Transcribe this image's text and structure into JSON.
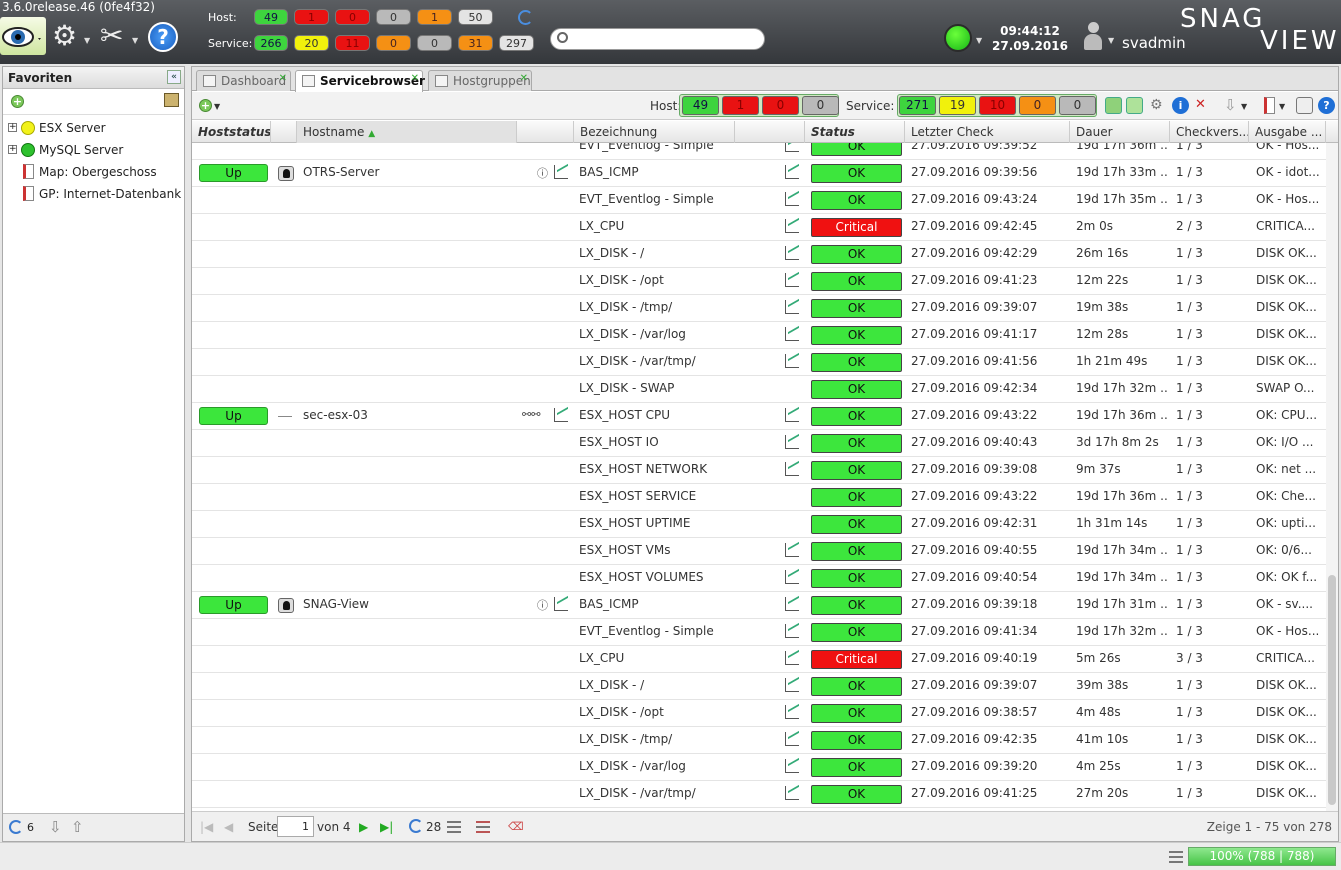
{
  "app": {
    "version": "3.6.0release.46 (0fe4f32)",
    "clock_time": "09:44:12",
    "clock_date": "27.09.2016",
    "username": "svadmin",
    "logo_top": "SNAG",
    "logo_bottom": "VIEW"
  },
  "top_summary": {
    "host_label": "Host:",
    "host_counts": [
      "49",
      "1",
      "0",
      "0",
      "1",
      "50"
    ],
    "service_label": "Service:",
    "service_counts": [
      "266",
      "20",
      "11",
      "0",
      "0",
      "31",
      "297"
    ]
  },
  "search": {
    "value": "",
    "placeholder": ""
  },
  "favorites": {
    "title": "Favoriten",
    "items": [
      {
        "label": "ESX Server",
        "icon": "yellow-status-icon"
      },
      {
        "label": "MySQL Server",
        "icon": "green-up-icon"
      },
      {
        "label": "Map: Obergeschoss",
        "icon": "map-icon"
      },
      {
        "label": "GP: Internet-Datenbank",
        "icon": "map-icon"
      }
    ],
    "footer_count": "6"
  },
  "tabs": [
    "Dashboard",
    "Servicebrowser",
    "Hostgruppen"
  ],
  "toolbar": {
    "host_label": "Host:",
    "host_counts": [
      "49",
      "1",
      "0",
      "0"
    ],
    "service_label": "Service:",
    "service_counts": [
      "271",
      "19",
      "10",
      "0",
      "0"
    ]
  },
  "columns": [
    "Hoststatus",
    "",
    "Hostname",
    "",
    "Bezeichnung",
    "",
    "Status",
    "Letzter Check",
    "Dauer",
    "Checkvers...",
    "Ausgabe ..."
  ],
  "rows": [
    {
      "host_status": "",
      "host": "",
      "service": "EVT_Eventlog - Simple",
      "status": "OK",
      "last_check": "27.09.2016 09:39:52",
      "duration": "19d 17h 36m ...",
      "attempt": "1 / 3",
      "output": "OK - Hos...",
      "chart": true
    },
    {
      "host_status": "Up",
      "host": "OTRS-Server",
      "host_icon": "tux",
      "service": "BAS_ICMP",
      "status": "OK",
      "last_check": "27.09.2016 09:39:56",
      "duration": "19d 17h 33m ...",
      "attempt": "1 / 3",
      "output": "OK - idot...",
      "chart": true
    },
    {
      "host_status": "",
      "host": "",
      "service": "EVT_Eventlog - Simple",
      "status": "OK",
      "last_check": "27.09.2016 09:43:24",
      "duration": "19d 17h 35m ...",
      "attempt": "1 / 3",
      "output": "OK - Hos...",
      "chart": true
    },
    {
      "host_status": "",
      "host": "",
      "service": "LX_CPU",
      "status": "Critical",
      "last_check": "27.09.2016 09:42:45",
      "duration": "2m 0s",
      "attempt": "2 / 3",
      "output": "CRITICA...",
      "chart": true
    },
    {
      "host_status": "",
      "host": "",
      "service": "LX_DISK - /",
      "status": "OK",
      "last_check": "27.09.2016 09:42:29",
      "duration": "26m 16s",
      "attempt": "1 / 3",
      "output": "DISK OK...",
      "chart": true
    },
    {
      "host_status": "",
      "host": "",
      "service": "LX_DISK - /opt",
      "status": "OK",
      "last_check": "27.09.2016 09:41:23",
      "duration": "12m 22s",
      "attempt": "1 / 3",
      "output": "DISK OK...",
      "chart": true
    },
    {
      "host_status": "",
      "host": "",
      "service": "LX_DISK - /tmp/",
      "status": "OK",
      "last_check": "27.09.2016 09:39:07",
      "duration": "19m 38s",
      "attempt": "1 / 3",
      "output": "DISK OK...",
      "chart": true
    },
    {
      "host_status": "",
      "host": "",
      "service": "LX_DISK - /var/log",
      "status": "OK",
      "last_check": "27.09.2016 09:41:17",
      "duration": "12m 28s",
      "attempt": "1 / 3",
      "output": "DISK OK...",
      "chart": true
    },
    {
      "host_status": "",
      "host": "",
      "service": "LX_DISK - /var/tmp/",
      "status": "OK",
      "last_check": "27.09.2016 09:41:56",
      "duration": "1h 21m 49s",
      "attempt": "1 / 3",
      "output": "DISK OK...",
      "chart": true
    },
    {
      "host_status": "",
      "host": "",
      "service": "LX_DISK - SWAP",
      "status": "OK",
      "last_check": "27.09.2016 09:42:34",
      "duration": "19d 17h 32m ...",
      "attempt": "1 / 3",
      "output": "SWAP O...",
      "chart": false
    },
    {
      "host_status": "Up",
      "host": "sec-esx-03",
      "host_icon": "esx",
      "service": "ESX_HOST CPU",
      "status": "OK",
      "last_check": "27.09.2016 09:43:22",
      "duration": "19d 17h 36m ...",
      "attempt": "1 / 3",
      "output": "OK: CPU...",
      "chart": true
    },
    {
      "host_status": "",
      "host": "",
      "service": "ESX_HOST IO",
      "status": "OK",
      "last_check": "27.09.2016 09:40:43",
      "duration": "3d 17h 8m 2s",
      "attempt": "1 / 3",
      "output": "OK: I/O ...",
      "chart": true
    },
    {
      "host_status": "",
      "host": "",
      "service": "ESX_HOST NETWORK",
      "status": "OK",
      "last_check": "27.09.2016 09:39:08",
      "duration": "9m 37s",
      "attempt": "1 / 3",
      "output": "OK: net ...",
      "chart": true
    },
    {
      "host_status": "",
      "host": "",
      "service": "ESX_HOST SERVICE",
      "status": "OK",
      "last_check": "27.09.2016 09:43:22",
      "duration": "19d 17h 36m ...",
      "attempt": "1 / 3",
      "output": "OK: Che...",
      "chart": false
    },
    {
      "host_status": "",
      "host": "",
      "service": "ESX_HOST UPTIME",
      "status": "OK",
      "last_check": "27.09.2016 09:42:31",
      "duration": "1h 31m 14s",
      "attempt": "1 / 3",
      "output": "OK: upti...",
      "chart": false
    },
    {
      "host_status": "",
      "host": "",
      "service": "ESX_HOST VMs",
      "status": "OK",
      "last_check": "27.09.2016 09:40:55",
      "duration": "19d 17h 34m ...",
      "attempt": "1 / 3",
      "output": "OK: 0/6...",
      "chart": true
    },
    {
      "host_status": "",
      "host": "",
      "service": "ESX_HOST VOLUMES",
      "status": "OK",
      "last_check": "27.09.2016 09:40:54",
      "duration": "19d 17h 34m ...",
      "attempt": "1 / 3",
      "output": "OK: OK f...",
      "chart": true
    },
    {
      "host_status": "Up",
      "host": "SNAG-View",
      "host_icon": "tux",
      "service": "BAS_ICMP",
      "status": "OK",
      "last_check": "27.09.2016 09:39:18",
      "duration": "19d 17h 31m ...",
      "attempt": "1 / 3",
      "output": "OK - sv....",
      "chart": true
    },
    {
      "host_status": "",
      "host": "",
      "service": "EVT_Eventlog - Simple",
      "status": "OK",
      "last_check": "27.09.2016 09:41:34",
      "duration": "19d 17h 32m ...",
      "attempt": "1 / 3",
      "output": "OK - Hos...",
      "chart": true
    },
    {
      "host_status": "",
      "host": "",
      "service": "LX_CPU",
      "status": "Critical",
      "last_check": "27.09.2016 09:40:19",
      "duration": "5m 26s",
      "attempt": "3 / 3",
      "output": "CRITICA...",
      "chart": true
    },
    {
      "host_status": "",
      "host": "",
      "service": "LX_DISK - /",
      "status": "OK",
      "last_check": "27.09.2016 09:39:07",
      "duration": "39m 38s",
      "attempt": "1 / 3",
      "output": "DISK OK...",
      "chart": true
    },
    {
      "host_status": "",
      "host": "",
      "service": "LX_DISK - /opt",
      "status": "OK",
      "last_check": "27.09.2016 09:38:57",
      "duration": "4m 48s",
      "attempt": "1 / 3",
      "output": "DISK OK...",
      "chart": true
    },
    {
      "host_status": "",
      "host": "",
      "service": "LX_DISK - /tmp/",
      "status": "OK",
      "last_check": "27.09.2016 09:42:35",
      "duration": "41m 10s",
      "attempt": "1 / 3",
      "output": "DISK OK...",
      "chart": true
    },
    {
      "host_status": "",
      "host": "",
      "service": "LX_DISK - /var/log",
      "status": "OK",
      "last_check": "27.09.2016 09:39:20",
      "duration": "4m 25s",
      "attempt": "1 / 3",
      "output": "DISK OK...",
      "chart": true
    },
    {
      "host_status": "",
      "host": "",
      "service": "LX_DISK - /var/tmp/",
      "status": "OK",
      "last_check": "27.09.2016 09:41:25",
      "duration": "27m 20s",
      "attempt": "1 / 3",
      "output": "DISK OK...",
      "chart": true
    }
  ],
  "pager": {
    "page_label": "Seite",
    "page_value": "1",
    "of_label": "von 4",
    "refresh_count": "28",
    "summary": "Zeige 1 - 75 von 278"
  },
  "statusbar": {
    "progress": "100% (788 | 788)"
  },
  "colors": {
    "ok": "#3de63d",
    "critical": "#f01111",
    "warning": "#f1f10c",
    "unknown": "#f59014",
    "pending": "#b9b9b9"
  }
}
